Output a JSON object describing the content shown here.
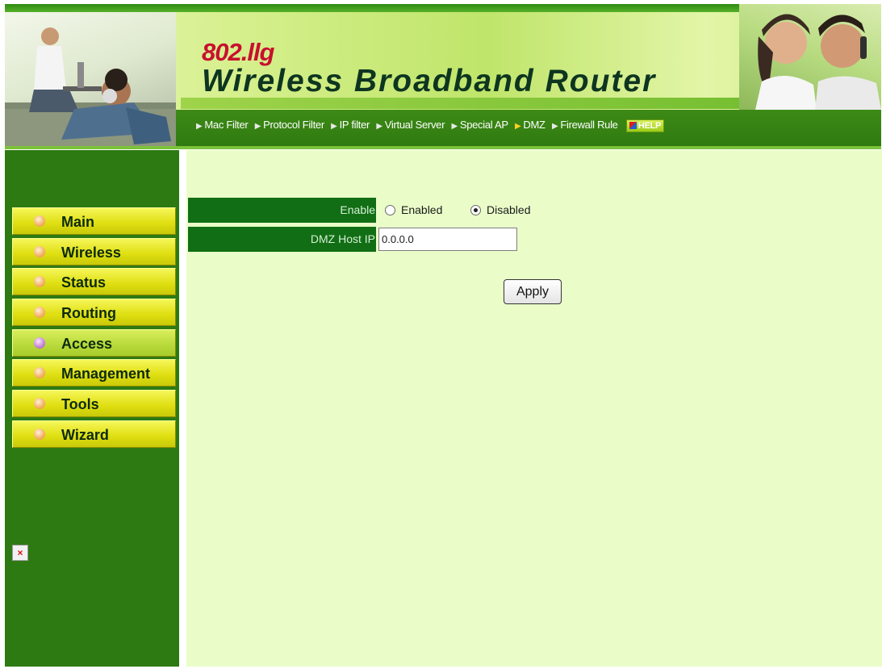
{
  "header": {
    "model": "802.llg",
    "title": "Wireless Broadband Router",
    "nav": [
      {
        "label": "Mac Filter",
        "active": false
      },
      {
        "label": "Protocol Filter",
        "active": false
      },
      {
        "label": "IP filter",
        "active": false
      },
      {
        "label": "Virtual Server",
        "active": false
      },
      {
        "label": "Special AP",
        "active": false
      },
      {
        "label": "DMZ",
        "active": true
      },
      {
        "label": "Firewall Rule",
        "active": false
      }
    ],
    "help_label": "HELP"
  },
  "sidebar": {
    "items": [
      {
        "label": "Main",
        "active": false
      },
      {
        "label": "Wireless",
        "active": false
      },
      {
        "label": "Status",
        "active": false
      },
      {
        "label": "Routing",
        "active": false
      },
      {
        "label": "Access",
        "active": true
      },
      {
        "label": "Management",
        "active": false
      },
      {
        "label": "Tools",
        "active": false
      },
      {
        "label": "Wizard",
        "active": false
      }
    ],
    "broken_image_glyph": "×"
  },
  "form": {
    "enable_label": "Enable",
    "enabled_option": "Enabled",
    "disabled_option": "Disabled",
    "selected": "Disabled",
    "dmz_host_label": "DMZ Host IP",
    "dmz_host_value": "0.0.0.0",
    "apply_label": "Apply"
  },
  "colors": {
    "sidebar_bg": "#2e7a12",
    "content_bg": "#eafdc9",
    "label_bg": "#116e14",
    "menu_yellow": "#dede10",
    "brand_red": "#c8102e"
  }
}
